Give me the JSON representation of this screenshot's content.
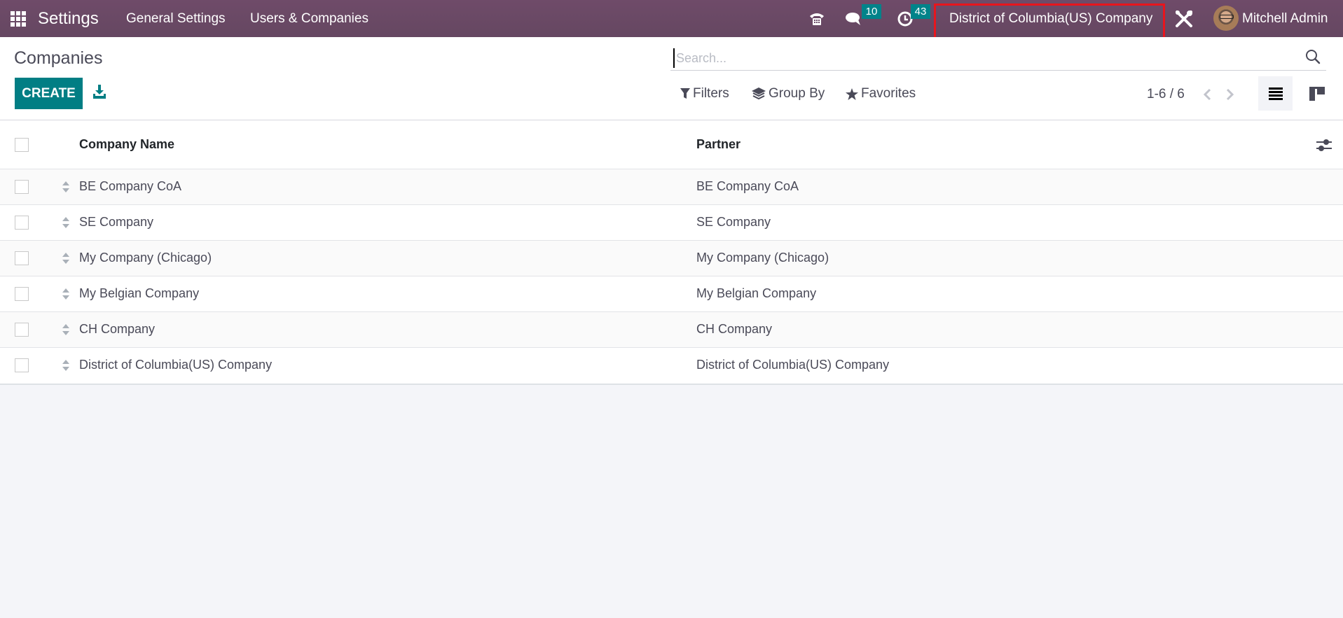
{
  "navbar": {
    "app_name": "Settings",
    "menus": [
      "General Settings",
      "Users & Companies"
    ],
    "icons": {
      "apps": "apps-grid-icon",
      "phone": "phone-icon",
      "chat": "chat-icon",
      "activity": "clock-icon",
      "debug": "tools-icon"
    },
    "chat_badge": "10",
    "activity_badge": "43",
    "current_company": "District of Columbia(US) Company",
    "user_name": "Mitchell Admin",
    "highlight_color": "#e8151d",
    "bar_color": "#6b4a67"
  },
  "control_panel": {
    "title": "Companies",
    "create_label": "CREATE",
    "search_placeholder": "Search...",
    "search_value": "",
    "filters_label": "Filters",
    "groupby_label": "Group By",
    "favorites_label": "Favorites",
    "pager": "1-6 / 6",
    "active_view": "list",
    "accent_color": "#017e84"
  },
  "table": {
    "columns": [
      "Company Name",
      "Partner"
    ],
    "rows": [
      {
        "name": "BE Company CoA",
        "partner": "BE Company CoA"
      },
      {
        "name": "SE Company",
        "partner": "SE Company"
      },
      {
        "name": "My Company (Chicago)",
        "partner": "My Company (Chicago)"
      },
      {
        "name": "My Belgian Company",
        "partner": "My Belgian Company"
      },
      {
        "name": "CH Company",
        "partner": "CH Company"
      },
      {
        "name": "District of Columbia(US) Company",
        "partner": "District of Columbia(US) Company"
      }
    ]
  }
}
